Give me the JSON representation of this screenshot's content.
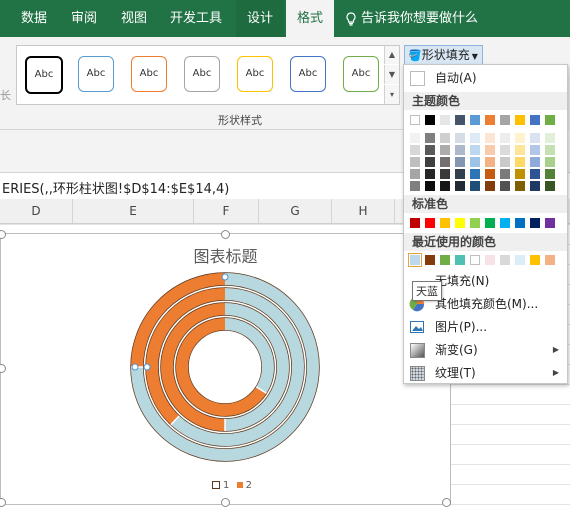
{
  "tabs": [
    {
      "label": "数据"
    },
    {
      "label": "审阅"
    },
    {
      "label": "视图"
    },
    {
      "label": "开发工具"
    },
    {
      "label": "设计"
    },
    {
      "label": "格式"
    }
  ],
  "tell_me": "告诉我你想要做什么",
  "ribbon": {
    "style_sample_label": "Abc",
    "group_label": "形状样式",
    "shape_fill_button": "形状填充",
    "left_cut_text": "长"
  },
  "style_swatches": [
    {
      "color": "#000000"
    },
    {
      "color": "#5b9bd5"
    },
    {
      "color": "#ed7d31"
    },
    {
      "color": "#a5a5a5"
    },
    {
      "color": "#ffc000"
    },
    {
      "color": "#4472c4"
    },
    {
      "color": "#70ad47"
    }
  ],
  "formula_bar": "ERIES(,,环形柱状图!$D$14:$E$14,4)",
  "columns": [
    {
      "label": "D"
    },
    {
      "label": "E"
    },
    {
      "label": "F"
    },
    {
      "label": "G"
    },
    {
      "label": "H"
    }
  ],
  "chart": {
    "title": "图表标题",
    "legend": [
      {
        "name": "1",
        "color": "#5e3a1e"
      },
      {
        "name": "2",
        "color": "#ed7d31"
      }
    ]
  },
  "chart_data": {
    "type": "doughnut",
    "title": "图表标题",
    "series": [
      {
        "name": "1",
        "color": "#b8d8e0"
      },
      {
        "name": "2",
        "color": "#ed7d31"
      }
    ],
    "rings": [
      {
        "orange_fraction": 0.25
      },
      {
        "orange_fraction": 0.38
      },
      {
        "orange_fraction": 0.5
      },
      {
        "orange_fraction": 0.66
      }
    ]
  },
  "fill_menu": {
    "auto_label": "自动(A)",
    "theme_colors_label": "主题颜色",
    "standard_colors_label": "标准色",
    "recent_colors_label": "最近使用的颜色",
    "no_fill_label": "无填充(N)",
    "more_colors_label": "其他填充颜色(M)...",
    "picture_label": "图片(P)...",
    "gradient_label": "渐变(G)",
    "texture_label": "纹理(T)",
    "tooltip": "天蓝"
  },
  "theme_colors": [
    "#ffffff",
    "#000000",
    "#e7e6e6",
    "#44546a",
    "#5b9bd5",
    "#ed7d31",
    "#a5a5a5",
    "#ffc000",
    "#4472c4",
    "#70ad47"
  ],
  "theme_shades": [
    [
      "#f2f2f2",
      "#7f7f7f",
      "#d0cece",
      "#d6dce4",
      "#deebf6",
      "#fbe5d5",
      "#ededed",
      "#fff2cc",
      "#d9e2f3",
      "#e2efd9"
    ],
    [
      "#d8d8d8",
      "#595959",
      "#aeabab",
      "#adb9ca",
      "#bdd7ee",
      "#f7cbac",
      "#dbdbdb",
      "#fee599",
      "#b4c6e7",
      "#c5e0b3"
    ],
    [
      "#bfbfbf",
      "#3f3f3f",
      "#757070",
      "#8496b0",
      "#9dc3e6",
      "#f4b183",
      "#c9c9c9",
      "#ffd965",
      "#8eaadb",
      "#a8d08d"
    ],
    [
      "#a5a5a5",
      "#262626",
      "#3a3838",
      "#323f4f",
      "#2e75b5",
      "#c55a11",
      "#7b7b7b",
      "#bf9000",
      "#2f5496",
      "#538135"
    ],
    [
      "#7f7f7f",
      "#0c0c0c",
      "#171616",
      "#222a35",
      "#1f4e79",
      "#833c0b",
      "#525252",
      "#7f6000",
      "#1f3864",
      "#375623"
    ]
  ],
  "standard_colors": [
    "#c00000",
    "#ff0000",
    "#ffc000",
    "#ffff00",
    "#92d050",
    "#00b050",
    "#00b0f0",
    "#0070c0",
    "#002060",
    "#7030a0"
  ],
  "recent_colors": [
    "#bdd7ee",
    "#843c0c",
    "#70ad47",
    "#4fc1b4",
    "#ffffff",
    "#f7e2e8",
    "#d8d8d8",
    "#dbeef8",
    "#ffc000",
    "#f4b183"
  ]
}
